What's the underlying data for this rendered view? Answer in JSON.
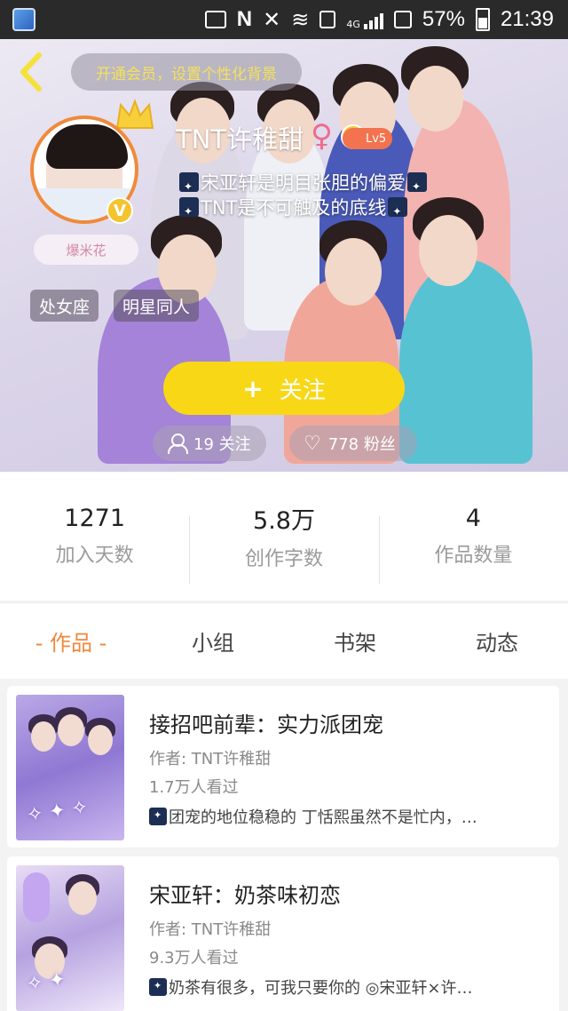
{
  "status_bar": {
    "battery": "57%",
    "time": "21:39",
    "network": "4G"
  },
  "header": {
    "vip_prompt": "开通会员，设置个性化背景",
    "username": "TNT许稚甜",
    "level": "Lv5",
    "badge_label": "爆米花",
    "bio_line1": "宋亚轩是明目张胆的偏爱",
    "bio_line2": "TNT是不可触及的底线",
    "tags": [
      "处女座",
      "明星同人"
    ],
    "follow_label": "关注",
    "following": "19 关注",
    "fans": "778 粉丝"
  },
  "stats": [
    {
      "value": "1271",
      "label": "加入天数"
    },
    {
      "value": "5.8万",
      "label": "创作字数"
    },
    {
      "value": "4",
      "label": "作品数量"
    }
  ],
  "tabs": [
    {
      "label": "- 作品 -",
      "active": true
    },
    {
      "label": "小组",
      "active": false
    },
    {
      "label": "书架",
      "active": false
    },
    {
      "label": "动态",
      "active": false
    }
  ],
  "works": [
    {
      "title": "接招吧前辈：实力派团宠",
      "author": "作者: TNT许稚甜",
      "views": "1.7万人看过",
      "desc": "团宠的地位稳稳的 丁恬熙虽然不是忙内，…"
    },
    {
      "title": "宋亚轩：奶茶味初恋",
      "author": "作者: TNT许稚甜",
      "views": "9.3万人看过",
      "desc": "奶茶有很多，可我只要你的 ◎宋亚轩×许…"
    }
  ],
  "colors": {
    "accent": "#f0883c",
    "follow_button": "#f8d717",
    "avatar_ring": "#f08a3a"
  }
}
